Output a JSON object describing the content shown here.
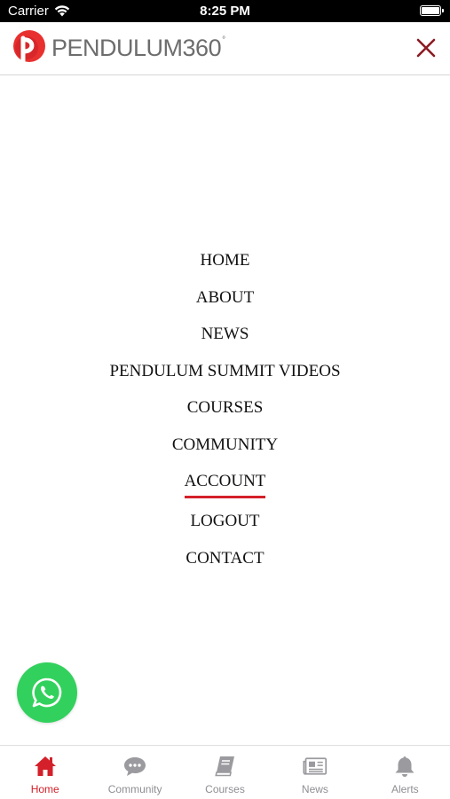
{
  "status_bar": {
    "carrier": "Carrier",
    "time": "8:25 PM",
    "battery_level": 1.0
  },
  "header": {
    "logo_text": "PENDULUM",
    "logo_number": "360",
    "logo_degree": "°",
    "brand_color": "#e8312f",
    "close_color": "#8b1a22"
  },
  "menu": {
    "items": [
      "HOME",
      "ABOUT",
      "NEWS",
      "PENDULUM SUMMIT VIDEOS",
      "COURSES",
      "COMMUNITY",
      "ACCOUNT",
      "LOGOUT",
      "CONTACT"
    ],
    "active_item": "ACCOUNT",
    "active_underline_color": "#d4202a"
  },
  "whatsapp": {
    "icon": "whatsapp-icon",
    "color": "#32d15d"
  },
  "tabbar": {
    "tabs": [
      {
        "label": "Home",
        "icon": "home-icon",
        "active": true
      },
      {
        "label": "Community",
        "icon": "chat-bubble-icon",
        "active": false
      },
      {
        "label": "Courses",
        "icon": "book-icon",
        "active": false
      },
      {
        "label": "News",
        "icon": "newspaper-icon",
        "active": false
      },
      {
        "label": "Alerts",
        "icon": "bell-icon",
        "active": false
      }
    ],
    "active_color": "#d4202a",
    "inactive_color": "#8e8e93"
  }
}
